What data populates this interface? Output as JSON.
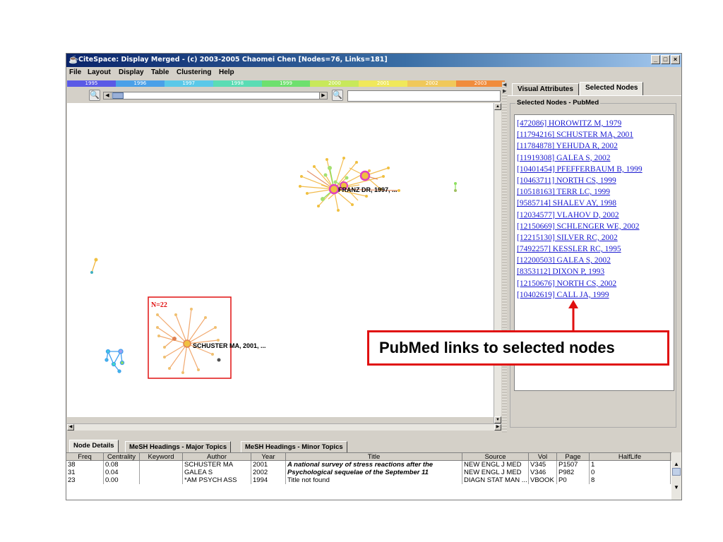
{
  "window": {
    "title": "CiteSpace: Display Merged - (c) 2003-2005 Chaomei Chen [Nodes=76, Links=181]",
    "controls": {
      "minimize": "_",
      "maximize": "□",
      "close": "×"
    }
  },
  "menu": [
    "File",
    "Layout",
    "Display",
    "Table",
    "Clustering",
    "Help"
  ],
  "timeline": {
    "years": [
      "1995",
      "1996",
      "1997",
      "1998",
      "1999",
      "2000",
      "2001",
      "2002",
      "2003"
    ],
    "colors": [
      "#5a5ae6",
      "#4aa0e8",
      "#5ac8e8",
      "#5adcb4",
      "#6ee06e",
      "#c8e85a",
      "#f0e85a",
      "#f0c85a",
      "#f08c3c"
    ]
  },
  "toolbar": {
    "zoom_out": "−",
    "zoom_in": "+",
    "search_value": ""
  },
  "graph": {
    "labels": {
      "franz": "FRANZ DR, 1997, ...",
      "schuster": "SCHUSTER MA, 2001, ...",
      "cluster_box": "N=22"
    }
  },
  "right_panel": {
    "tabs": [
      "Visual Attributes",
      "Selected Nodes"
    ],
    "active_tab": "Selected Nodes",
    "group_label": "Selected Nodes - PubMed",
    "links": [
      "[472086] HOROWITZ M, 1979",
      "[11794216] SCHUSTER MA, 2001",
      "[11784878] YEHUDA R, 2002",
      "[11919308] GALEA S, 2002",
      "[10401454] PFEFFERBAUM B, 1999",
      "[10463711] NORTH CS, 1999",
      "[10518163] TERR LC, 1999",
      "[9585714] SHALEV AY, 1998",
      "[12034577] VLAHOV D, 2002",
      "[12150669] SCHLENGER WE, 2002",
      "[12215130] SILVER RC, 2002",
      "[7492257] KESSLER RC, 1995",
      "[12200503] GALEA S, 2002",
      "[8353112] DIXON P, 1993",
      "[12150676] NORTH CS, 2002",
      "[10402619] CALL JA, 1999"
    ]
  },
  "callout": {
    "text": "PubMed links to selected nodes",
    "color": "#e01010"
  },
  "bottom_tabs": [
    "Node Details",
    "MeSH Headings - Major Topics",
    "MeSH Headings - Minor Topics"
  ],
  "table": {
    "columns": [
      "Freq",
      "Centrality",
      "Keyword",
      "Author",
      "Year",
      "Title",
      "Source",
      "Vol",
      "Page",
      "HalfLife"
    ],
    "rows": [
      [
        "38",
        "0.08",
        "",
        "SCHUSTER MA",
        "2001",
        "A national survey of stress reactions after the",
        "NEW ENGL J MED",
        "V345",
        "P1507",
        "1"
      ],
      [
        "31",
        "0.04",
        "",
        "GALEA S",
        "2002",
        "Psychological sequelae of the September 11",
        "NEW ENGL J MED",
        "V346",
        "P982",
        "0"
      ],
      [
        "23",
        "0.00",
        "",
        "*AM PSYCH ASS",
        "1994",
        "Title not found",
        "DIAGN STAT MAN ...",
        "VBOOK",
        "P0",
        "8"
      ]
    ]
  }
}
